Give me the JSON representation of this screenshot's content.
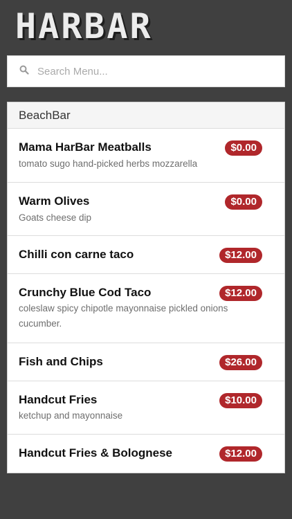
{
  "app": {
    "logo": "HARBAR"
  },
  "search": {
    "placeholder": "Search Menu..."
  },
  "section": {
    "title": "BeachBar"
  },
  "items": [
    {
      "name": "Mama HarBar Meatballs",
      "description": "tomato sugo hand-picked herbs mozzarella",
      "price": "$0.00"
    },
    {
      "name": "Warm Olives",
      "description": "Goats cheese dip",
      "price": "$0.00"
    },
    {
      "name": "Chilli con carne taco",
      "description": "",
      "price": "$12.00"
    },
    {
      "name": "Crunchy Blue Cod Taco",
      "description": "coleslaw spicy chipotle mayonnaise pickled onions cucumber.",
      "price": "$12.00"
    },
    {
      "name": "Fish and Chips",
      "description": "",
      "price": "$26.00"
    },
    {
      "name": "Handcut Fries",
      "description": "ketchup and mayonnaise",
      "price": "$10.00"
    },
    {
      "name": "Handcut Fries & Bolognese",
      "description": "",
      "price": "$12.00"
    }
  ],
  "colors": {
    "background": "#404040",
    "price_badge": "#b0272b"
  }
}
